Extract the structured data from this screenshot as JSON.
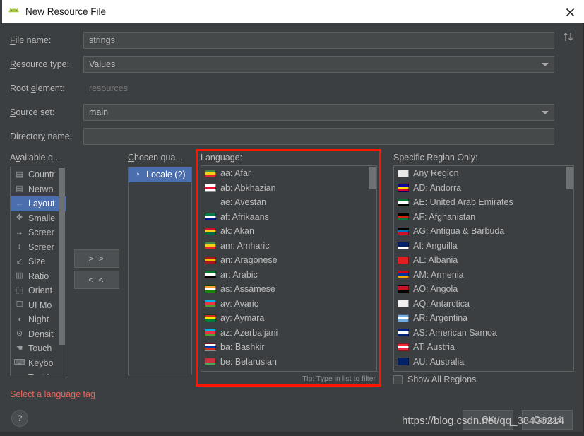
{
  "window": {
    "title": "New Resource File",
    "app_icon": "android-icon",
    "close_icon": "close-icon"
  },
  "form": {
    "file_name": {
      "label": "File name:",
      "mnemonic": "F",
      "value": "strings"
    },
    "resource_type": {
      "label": "Resource type:",
      "mnemonic": "R",
      "value": "Values",
      "icon": "chevron-down-icon"
    },
    "root_element": {
      "label": "Root element:",
      "mnemonic": "e",
      "value": "resources"
    },
    "source_set": {
      "label": "Source set:",
      "mnemonic": "S",
      "value": "main",
      "icon": "chevron-down-icon"
    },
    "directory_name": {
      "label": "Directory name:",
      "mnemonic": "y",
      "value": ""
    },
    "sort_icon": "sort-updown-icon"
  },
  "available_qualifiers": {
    "label": "Available q...",
    "mnemonic": "v",
    "items": [
      {
        "label": "Countr",
        "icon": "country-code-icon",
        "selected": false
      },
      {
        "label": "Netwo",
        "icon": "network-code-icon",
        "selected": false
      },
      {
        "label": "Layout",
        "icon": "layout-direction-icon",
        "selected": true
      },
      {
        "label": "Smalle",
        "icon": "smallest-width-icon",
        "selected": false
      },
      {
        "label": "Screer",
        "icon": "screen-width-icon",
        "selected": false
      },
      {
        "label": "Screer",
        "icon": "screen-height-icon",
        "selected": false
      },
      {
        "label": "Size",
        "icon": "size-icon",
        "selected": false
      },
      {
        "label": "Ratio",
        "icon": "ratio-icon",
        "selected": false
      },
      {
        "label": "Orient",
        "icon": "orientation-icon",
        "selected": false
      },
      {
        "label": "UI Mo",
        "icon": "ui-mode-icon",
        "selected": false
      },
      {
        "label": "Night",
        "icon": "night-mode-icon",
        "selected": false
      },
      {
        "label": "Densit",
        "icon": "density-icon",
        "selected": false
      },
      {
        "label": "Touch",
        "icon": "touch-screen-icon",
        "selected": false
      },
      {
        "label": "Keybo",
        "icon": "keyboard-icon",
        "selected": false
      },
      {
        "label": "Text Ir",
        "icon": "text-input-icon",
        "selected": false
      }
    ]
  },
  "chosen_qualifiers": {
    "label": "Chosen qua...",
    "mnemonic": "C",
    "items": [
      {
        "label": "Locale (?)",
        "icon": "globe-icon",
        "selected": true
      }
    ]
  },
  "transfer": {
    "add_label": "> >",
    "remove_label": "< <"
  },
  "language": {
    "label": "Language:",
    "tip": "Tip: Type in list to filter",
    "items": [
      {
        "label": "aa: Afar",
        "flag": "flag-et",
        "colors": [
          "#3f8b3f",
          "#f5d116",
          "#e0282e"
        ]
      },
      {
        "label": "ab: Abkhazian",
        "flag": "flag-ge",
        "colors": [
          "#ffffff",
          "#e8112d",
          "#ffffff"
        ]
      },
      {
        "label": "ae: Avestan",
        "flag": "none",
        "colors": []
      },
      {
        "label": "af: Afrikaans",
        "flag": "flag-za",
        "colors": [
          "#007a4d",
          "#ffffff",
          "#001489"
        ]
      },
      {
        "label": "ak: Akan",
        "flag": "flag-gh",
        "colors": [
          "#ce1126",
          "#fcd116",
          "#006b3f"
        ]
      },
      {
        "label": "am: Amharic",
        "flag": "flag-et",
        "colors": [
          "#3f8b3f",
          "#f5d116",
          "#e0282e"
        ]
      },
      {
        "label": "an: Aragonese",
        "flag": "flag-es",
        "colors": [
          "#aa151b",
          "#f1bf00",
          "#aa151b"
        ]
      },
      {
        "label": "ar: Arabic",
        "flag": "flag-ae",
        "colors": [
          "#00732f",
          "#ffffff",
          "#000000"
        ]
      },
      {
        "label": "as: Assamese",
        "flag": "flag-in",
        "colors": [
          "#ff9933",
          "#ffffff",
          "#138808"
        ]
      },
      {
        "label": "av: Avaric",
        "flag": "flag-az",
        "colors": [
          "#00b5e2",
          "#ef3340",
          "#509e2f"
        ]
      },
      {
        "label": "ay: Aymara",
        "flag": "flag-bo",
        "colors": [
          "#d52b1e",
          "#f9e300",
          "#007934"
        ]
      },
      {
        "label": "az: Azerbaijani",
        "flag": "flag-az",
        "colors": [
          "#00b5e2",
          "#ef3340",
          "#509e2f"
        ]
      },
      {
        "label": "ba: Bashkir",
        "flag": "flag-ru",
        "colors": [
          "#ffffff",
          "#0039a6",
          "#d52b1e"
        ]
      },
      {
        "label": "be: Belarusian",
        "flag": "flag-by",
        "colors": [
          "#c8313e",
          "#c8313e",
          "#4aa657"
        ]
      }
    ]
  },
  "region": {
    "label": "Specific Region Only:",
    "show_all_label": "Show All Regions",
    "show_all_checked": false,
    "items": [
      {
        "label": "Any Region",
        "flag": "flag-any",
        "colors": [
          "#e8e8e8",
          "#e8e8e8",
          "#e8e8e8"
        ]
      },
      {
        "label": "AD: Andorra",
        "flag": "flag-ad",
        "colors": [
          "#10069f",
          "#fedf00",
          "#d50032"
        ]
      },
      {
        "label": "AE: United Arab Emirates",
        "flag": "flag-ae",
        "colors": [
          "#00732f",
          "#ffffff",
          "#000000"
        ]
      },
      {
        "label": "AF: Afghanistan",
        "flag": "flag-af",
        "colors": [
          "#000000",
          "#d32011",
          "#007a36"
        ]
      },
      {
        "label": "AG: Antigua & Barbuda",
        "flag": "flag-ag",
        "colors": [
          "#000000",
          "#0072c6",
          "#ce1126"
        ]
      },
      {
        "label": "AI: Anguilla",
        "flag": "flag-ai",
        "colors": [
          "#012169",
          "#012169",
          "#ffffff"
        ]
      },
      {
        "label": "AL: Albania",
        "flag": "flag-al",
        "colors": [
          "#e41e20",
          "#e41e20",
          "#e41e20"
        ]
      },
      {
        "label": "AM: Armenia",
        "flag": "flag-am",
        "colors": [
          "#d90012",
          "#0033a0",
          "#f2a800"
        ]
      },
      {
        "label": "AO: Angola",
        "flag": "flag-ao",
        "colors": [
          "#ce1126",
          "#ce1126",
          "#000000"
        ]
      },
      {
        "label": "AQ: Antarctica",
        "flag": "flag-aq",
        "colors": [
          "#f0f0f0",
          "#f0f0f0",
          "#f0f0f0"
        ]
      },
      {
        "label": "AR: Argentina",
        "flag": "flag-ar",
        "colors": [
          "#74acdf",
          "#ffffff",
          "#74acdf"
        ]
      },
      {
        "label": "AS: American Samoa",
        "flag": "flag-as",
        "colors": [
          "#00247d",
          "#ffffff",
          "#00247d"
        ]
      },
      {
        "label": "AT: Austria",
        "flag": "flag-at",
        "colors": [
          "#ed2939",
          "#ffffff",
          "#ed2939"
        ]
      },
      {
        "label": "AU: Australia",
        "flag": "flag-au",
        "colors": [
          "#012169",
          "#012169",
          "#012169"
        ]
      }
    ]
  },
  "footer": {
    "error": "Select a language tag",
    "help_label": "?",
    "ok_label": "OK",
    "cancel_label": "Cancel",
    "watermark": "https://blog.csdn.net/qq_38436214"
  },
  "colors": {
    "background": "#3c3f41",
    "field": "#45494a",
    "border": "#5e6060",
    "selection": "#4b6eaf",
    "text": "#bbbbbb",
    "muted": "#7a7a7a",
    "error": "#e9655b",
    "annotation": "#ff1500"
  }
}
